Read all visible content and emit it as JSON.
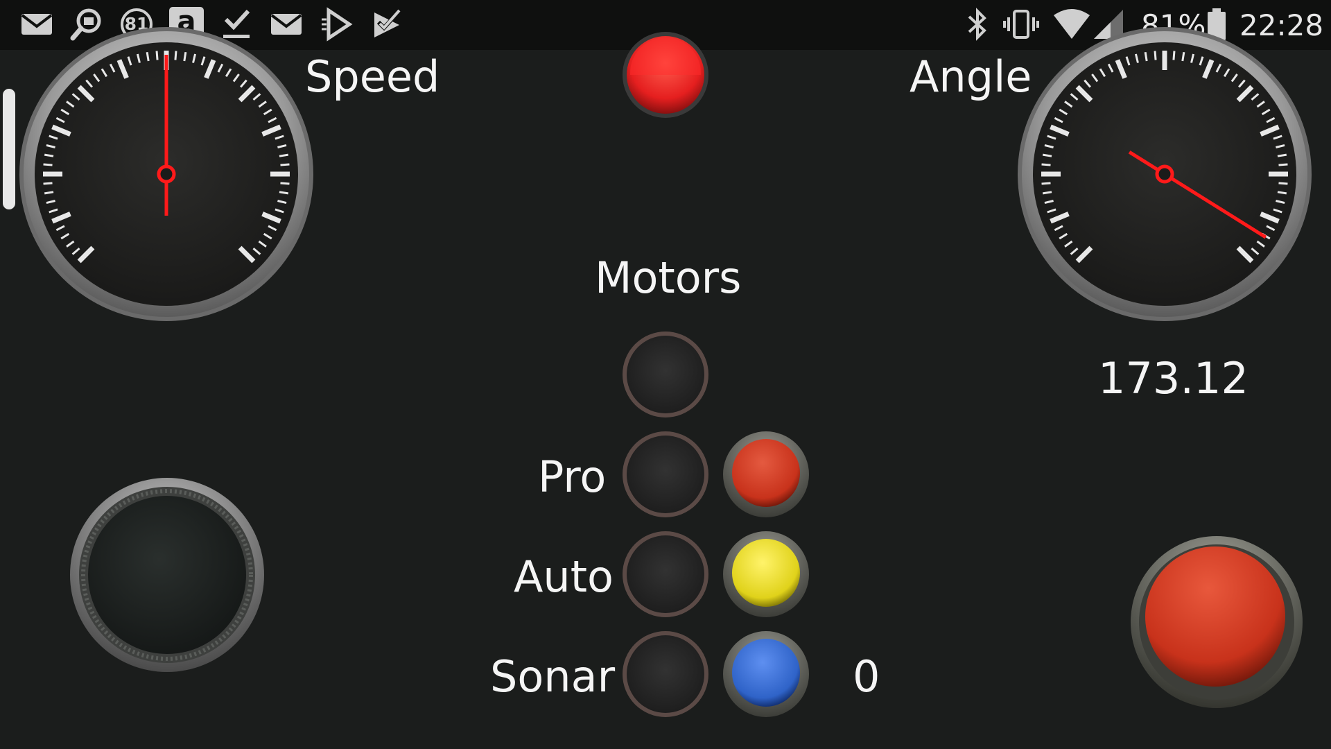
{
  "status_bar": {
    "left_icons": [
      "mail-icon",
      "search-badge-icon",
      "badge-81-icon",
      "amazon-icon",
      "download-check-icon",
      "mail-icon",
      "play-store-icon",
      "task-check-icon"
    ],
    "badge_number": "81",
    "amazon_glyph": "a",
    "battery_percent": "81%",
    "time": "22:28"
  },
  "speed_gauge": {
    "label": "Speed",
    "needle_angle_deg": 0,
    "needle_color": "#ff1a1a"
  },
  "angle_gauge": {
    "label": "Angle",
    "needle_angle_deg": 122,
    "value": "173.12",
    "needle_color": "#ff1a1a"
  },
  "top_indicator": {
    "color": "#e51f1f"
  },
  "motors": {
    "title": "Motors",
    "rows": [
      {
        "label": "",
        "led": "off",
        "button_color": null
      },
      {
        "label": "Pro",
        "led": "off",
        "button_color": "#c8321b"
      },
      {
        "label": "Auto",
        "led": "off",
        "button_color": "#e0d21a"
      },
      {
        "label": "Sonar",
        "led": "off",
        "button_color": "#2f63c8"
      }
    ],
    "sonar_value": "0"
  },
  "action_button": {
    "color": "#c8321b"
  },
  "colors": {
    "background": "#1b1d1c",
    "status_bar": "#0f100f"
  }
}
